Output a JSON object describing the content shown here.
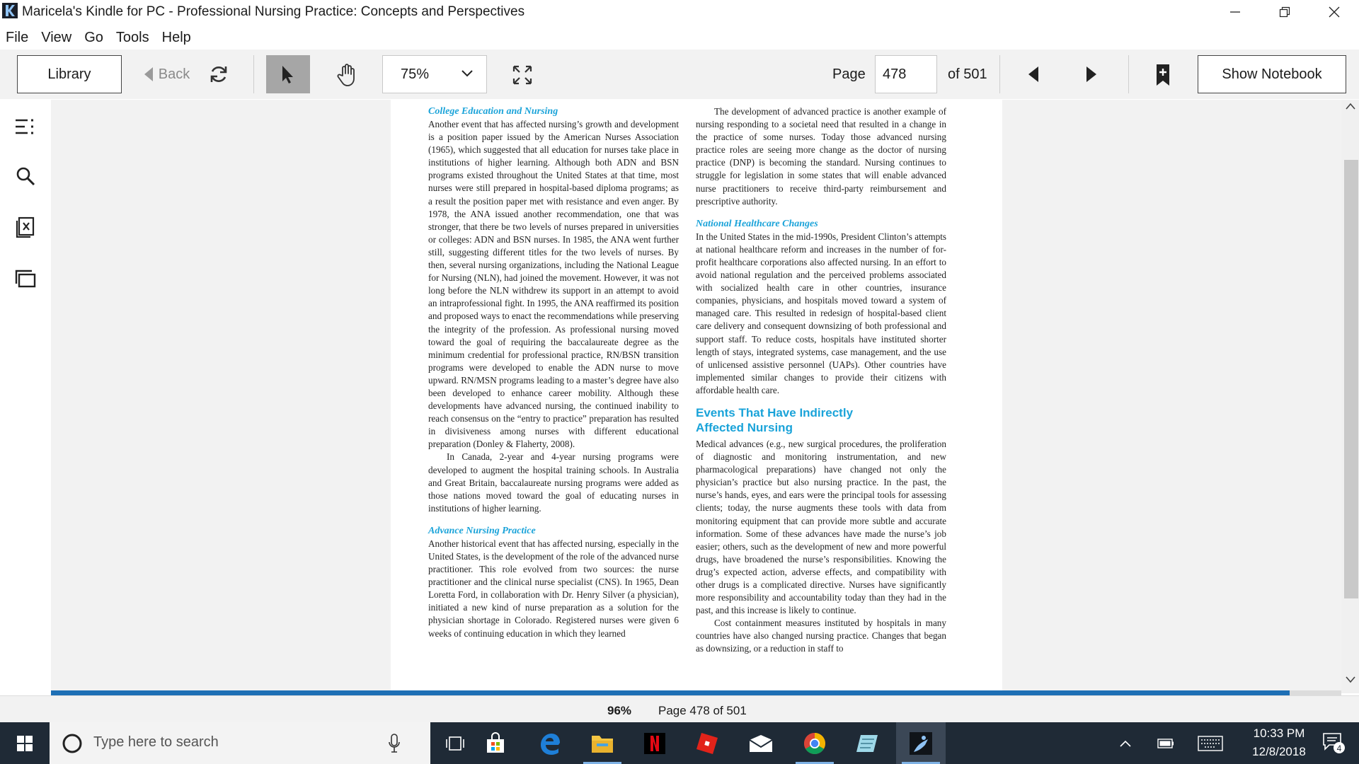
{
  "window": {
    "title": "Maricela's Kindle for PC - Professional Nursing Practice: Concepts and Perspectives"
  },
  "menu": [
    "File",
    "View",
    "Go",
    "Tools",
    "Help"
  ],
  "toolbar": {
    "library_label": "Library",
    "back_label": "Back",
    "zoom_value": "75%",
    "page_label": "Page",
    "page_value": "478",
    "page_of": "of 501",
    "notebook_label": "Show Notebook"
  },
  "book": {
    "left": {
      "h1": "College Education and Nursing",
      "p1": "Another event that has affected nursing’s growth and development is a position paper issued by the American Nurses Association (1965), which suggested that all education for nurses take place in institutions of higher learning. Although both ADN and BSN programs existed throughout the United States at that time, most nurses were still prepared in hospital-based diploma programs; as a result the position paper met with resistance and even anger. By 1978, the ANA issued another recommendation, one that was stronger, that there be two levels of nurses prepared in universities or colleges: ADN and BSN nurses. In 1985, the ANA went further still, suggesting different titles for the two levels of nurses. By then, several nursing organizations, including the National League for Nursing (NLN), had joined the movement. However, it was not long before the NLN withdrew its support in an attempt to avoid an intraprofessional fight. In 1995, the ANA reaffirmed its position and proposed ways to enact the recommendations while preserving the integrity of the profession. As professional nursing moved toward the goal of requiring the baccalaureate degree as the minimum credential for professional practice, RN/BSN transition programs were developed to enable the ADN nurse to move upward. RN/MSN programs leading to a master’s degree have also been developed to enhance career mobility. Although these developments have advanced nursing, the continued inability to reach consensus on the “entry to practice” preparation has resulted in divisiveness among nurses with different educational preparation (Donley & Flaherty, 2008).",
      "p2": "In Canada, 2-year and 4-year nursing programs were developed to augment the hospital training schools. In Australia and Great Britain, baccalaureate nursing programs were added as those nations moved toward the goal of educating nurses in institutions of higher learning.",
      "h2": "Advance Nursing Practice",
      "p3": "Another historical event that has affected nursing, especially in the United States, is the development of the role of the advanced nurse practitioner. This role evolved from two sources: the nurse practitioner and the clinical nurse specialist (CNS). In 1965, Dean Loretta Ford, in collaboration with Dr. Henry Silver (a physician), initiated a new kind of nurse preparation as a solution for the physician shortage in Colorado. Registered nurses were given 6 weeks of continuing education in which they learned"
    },
    "right": {
      "p1": "The development of advanced practice is another example of nursing responding to a societal need that resulted in a change in the practice of some nurses. Today those advanced nursing practice roles are seeing more change as the doctor of nursing practice (DNP) is becoming the standard. Nursing continues to struggle for legislation in some states that will enable advanced nurse practitioners to receive third-party reimbursement and prescriptive authority.",
      "h1": "National Healthcare Changes",
      "p2": "In the United States in the mid-1990s, President Clinton’s attempts at national healthcare reform and increases in the number of for-profit healthcare corporations also affected nursing. In an effort to avoid national regulation and the perceived problems associated with socialized health care in other countries, insurance companies, physicians, and hospitals moved toward a system of managed care. This resulted in redesign of hospital-based client care delivery and consequent downsizing of both professional and support staff. To reduce costs, hospitals have instituted shorter length of stays, integrated systems, case management, and the use of unlicensed assistive personnel (UAPs). Other countries have implemented similar changes to provide their citizens with affordable health care.",
      "h2a": "Events That Have Indirectly",
      "h2b": "Affected Nursing",
      "p3": "Medical advances (e.g., new surgical procedures, the proliferation of diagnostic and monitoring instrumentation, and new pharmacological preparations) have changed not only the physician’s practice but also nursing practice. In the past, the nurse’s hands, eyes, and ears were the principal tools for assessing clients; today, the nurse augments these tools with data from monitoring equipment that can provide more subtle and accurate information. Some of these advances have made the nurse’s job easier; others, such as the development of new and more powerful drugs, have broadened the nurse’s responsibilities. Knowing the drug’s expected action, adverse effects, and compatibility with other drugs is a complicated directive. Nurses have significantly more responsibility and accountability today than they had in the past, and this increase is likely to continue.",
      "p4": "Cost containment measures instituted by hospitals in many countries have also changed nursing practice. Changes that began as downsizing, or a reduction in staff to"
    }
  },
  "status": {
    "percent": "96%",
    "progress": 0.96,
    "page_text": "Page 478 of 501"
  },
  "taskbar": {
    "search_placeholder": "Type here to search",
    "time": "10:33 PM",
    "date": "12/8/2018",
    "notifications": "4"
  },
  "colors": {
    "accent": "#1e6fb5",
    "heading": "#1aa3d9",
    "taskbar": "#1f2a36"
  }
}
